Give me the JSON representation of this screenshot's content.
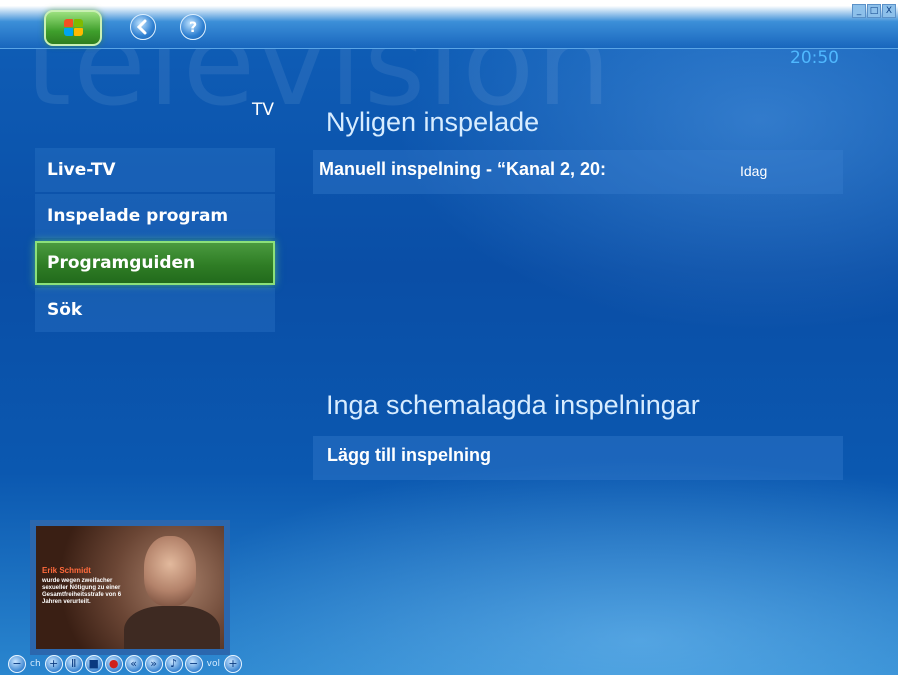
{
  "app": {
    "watermark": "television"
  },
  "header": {
    "clock": "20:50"
  },
  "window_controls": {
    "minimize": "_",
    "maximize": "□",
    "close": "X"
  },
  "page": {
    "title": "TV"
  },
  "menu": {
    "items": [
      {
        "label": "Live-TV",
        "selected": false
      },
      {
        "label": "Inspelade program",
        "selected": false
      },
      {
        "label": "Programguiden",
        "selected": true
      },
      {
        "label": "Sök",
        "selected": false
      }
    ]
  },
  "recent": {
    "title": "Nyligen inspelade",
    "items": [
      {
        "title": "Manuell inspelning - “Kanal 2, 20:",
        "date": "Idag"
      }
    ]
  },
  "scheduled": {
    "title": "Inga schemalagda inspelningar",
    "add_label": "Lägg till inspelning"
  },
  "preview": {
    "name": "Erik Schmidt",
    "caption": "wurde wegen zweifacher sexueller Nötigung zu einer Gesamtfreiheitsstrafe von 6 Jahren verurteilt."
  },
  "transport": {
    "ch_label": "ch",
    "vol_label": "vol"
  },
  "colors": {
    "accent_green": "#3f9f2c",
    "clock_blue": "#4fb8ff",
    "background": "#0b4aa0"
  }
}
